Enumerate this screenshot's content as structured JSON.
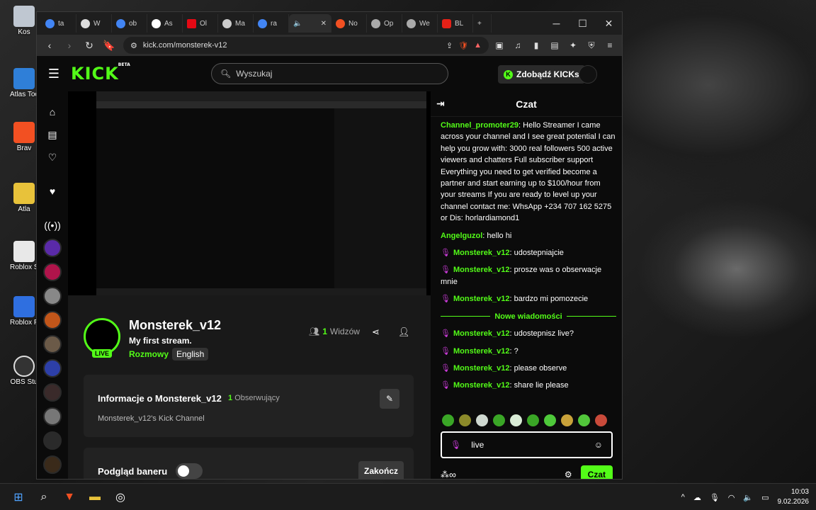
{
  "desktop": {
    "icons": [
      {
        "label": "Kos"
      },
      {
        "label": "Atlas Too"
      },
      {
        "label": "Brav"
      },
      {
        "label": "Atla"
      },
      {
        "label": "Roblox S"
      },
      {
        "label": "Roblox P"
      },
      {
        "label": "OBS Stu"
      }
    ]
  },
  "browser": {
    "tabs": [
      "ta",
      "W",
      "ob",
      "As",
      "Ol",
      "Ma",
      "ra",
      "",
      "No",
      "Op",
      "We",
      "BL"
    ],
    "url": "kick.com/monsterek-v12"
  },
  "kick": {
    "logo": "KICK",
    "logo_beta": "BETA",
    "search_placeholder": "Wyszukaj",
    "get_kicks": "Zdobądź KICKs"
  },
  "stream": {
    "live_badge": "LIVE",
    "streamer": "Monsterek_v12",
    "title": "My first stream.",
    "category": "Rozmowy",
    "language": "English",
    "viewers_count": "1",
    "viewers_label": "Widzów"
  },
  "info_card": {
    "title": "Informacje o Monsterek_v12",
    "followers_count": "1",
    "followers_label": "Obserwujący",
    "description": "Monsterek_v12's Kick Channel"
  },
  "banner_card": {
    "title": "Podgląd baneru",
    "end_label": "Zakończ"
  },
  "chat": {
    "header": "Czat",
    "messages": [
      {
        "user": "Channel_promoter29",
        "text": "Hello Streamer I came across your channel and I see great potential I can help you grow with: 3000 real followers 500 active viewers and chatters Full subscriber support Everything you need to get verified become a partner and start earning up to $100/hour from your streams If you are ready to level up your channel contact me: WhsApp +234 707 162 5275 or Dis: horlardiamond1"
      },
      {
        "user": "Angelguzol",
        "text": "hello hi"
      },
      {
        "user": "Monsterek_v12",
        "text": "udostepniajcie"
      },
      {
        "user": "Monsterek_v12",
        "text": "prosze was o obserwacje mnie"
      },
      {
        "user": "Monsterek_v12",
        "text": "bardzo mi pomozecie"
      }
    ],
    "new_messages_label": "Nowe wiadomości",
    "new_messages": [
      {
        "user": "Monsterek_v12",
        "text": "udostepnisz live?"
      },
      {
        "user": "Monsterek_v12",
        "text": "?"
      },
      {
        "user": "Monsterek_v12",
        "text": "please observe"
      },
      {
        "user": "Monsterek_v12",
        "text": "share lie please"
      }
    ],
    "input_value": "live",
    "send_label": "Czat"
  },
  "taskbar": {
    "time": "10:03",
    "date": "9.02.2026"
  },
  "colors": {
    "accent": "#53fc18",
    "mic": "#c83bd6"
  }
}
